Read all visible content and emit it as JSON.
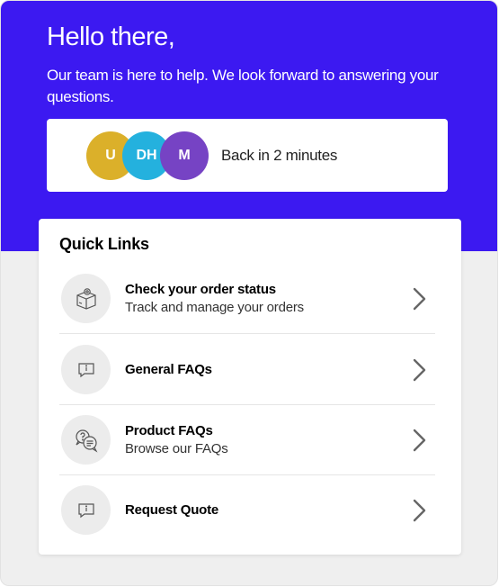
{
  "hero": {
    "greeting": "Hello there,",
    "subtitle": "Our team is here to help. We look forward to answering your questions."
  },
  "status": {
    "avatars": [
      {
        "initials": "U",
        "color": "#dbb02a"
      },
      {
        "initials": "DH",
        "color": "#24b1de"
      },
      {
        "initials": "M",
        "color": "#7643c4"
      }
    ],
    "text": "Back in 2 minutes"
  },
  "quick_links": {
    "title": "Quick Links",
    "items": [
      {
        "title": "Check your order status",
        "description": "Track and manage your orders",
        "icon": "package-icon"
      },
      {
        "title": "General FAQs",
        "description": "",
        "icon": "info-chat-icon"
      },
      {
        "title": "Product FAQs",
        "description": "Browse our FAQs",
        "icon": "question-chat-icon"
      },
      {
        "title": "Request Quote",
        "description": "",
        "icon": "info-chat-icon"
      }
    ]
  },
  "colors": {
    "brand": "#3c19f1",
    "background": "#efefef"
  }
}
